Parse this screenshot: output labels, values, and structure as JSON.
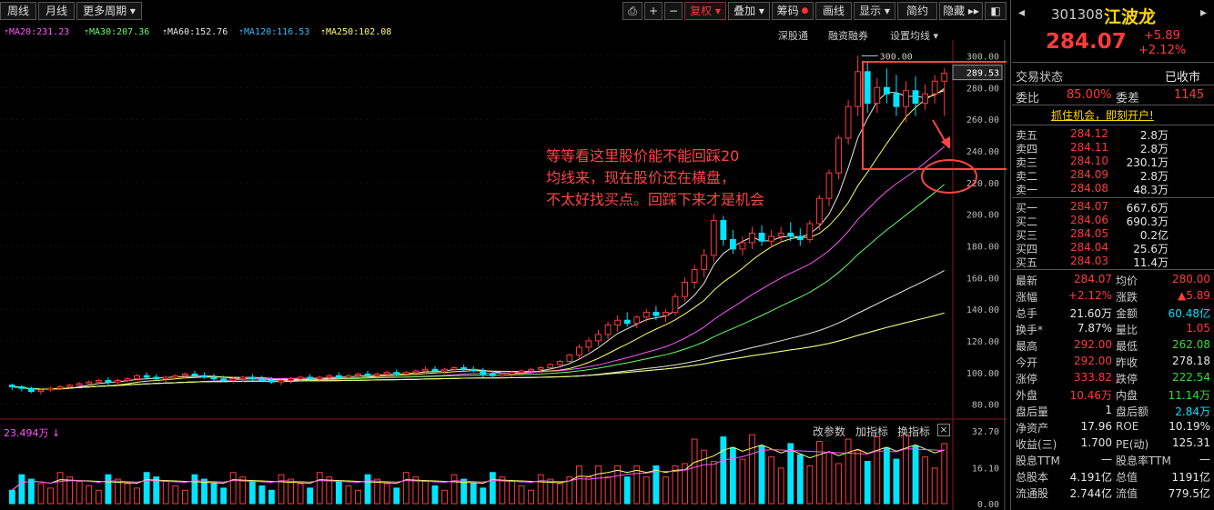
{
  "toolbar": {
    "weekly": "周线",
    "monthly": "月线",
    "more_period": "更多周期 ▾",
    "restore": "复权 ▾",
    "overlay": "叠加 ▾",
    "chips": "筹码",
    "draw": "画线",
    "display": "显示 ▾",
    "simple": "简约",
    "hide": "隐藏 ▸▸",
    "lock_icon": "lock-icon",
    "plus": "+",
    "minus": "−"
  },
  "ma_legend": [
    {
      "label": "MA20:231.23",
      "color": "#ff55ff"
    },
    {
      "label": "MA30:207.36",
      "color": "#66ff66"
    },
    {
      "label": "MA60:152.76",
      "color": "#e8e8e8"
    },
    {
      "label": "MA120:116.53",
      "color": "#33bbff"
    },
    {
      "label": "MA250:102.08",
      "color": "#ffff66"
    }
  ],
  "chart_links": {
    "sgt": "深股通",
    "margin": "融资融券",
    "set_ma": "设置均线 ▾"
  },
  "annotation": [
    "等等看这里股价能不能回踩20",
    "均线来，现在股价还在横盘，",
    "不太好找买点。回踩下来才是机会"
  ],
  "price_axis": {
    "ticks": [
      "300.00",
      "280.00",
      "260.00",
      "240.00",
      "220.00",
      "200.00",
      "180.00",
      "160.00",
      "140.00",
      "120.00",
      "100.00",
      "80.00"
    ],
    "current": "289.53",
    "high_marker": "300.00"
  },
  "volume_panel": {
    "ma_label": "23.494万 ↓",
    "buttons": {
      "params": "改参数",
      "add": "加指标",
      "switch": "换指标",
      "close": "×"
    },
    "ticks": [
      "32.70",
      "16.10",
      "0.00"
    ]
  },
  "stock": {
    "code": "301308",
    "name": "江波龙",
    "price": "284.07",
    "change": "+5.89",
    "pct": "+2.12%"
  },
  "trade_status": {
    "label": "交易状态",
    "value": "已收市"
  },
  "commission": {
    "ratio_label": "委比",
    "ratio": "85.00%",
    "diff_label": "委差",
    "diff": "1145"
  },
  "promo": "抓住机会，即刻开户!",
  "asks": [
    {
      "label": "卖五",
      "price": "284.12",
      "vol": "2.8万"
    },
    {
      "label": "卖四",
      "price": "284.11",
      "vol": "2.8万"
    },
    {
      "label": "卖三",
      "price": "284.10",
      "vol": "230.1万"
    },
    {
      "label": "卖二",
      "price": "284.09",
      "vol": "2.8万"
    },
    {
      "label": "卖一",
      "price": "284.08",
      "vol": "48.3万"
    }
  ],
  "bids": [
    {
      "label": "买一",
      "price": "284.07",
      "vol": "667.6万"
    },
    {
      "label": "买二",
      "price": "284.06",
      "vol": "690.3万"
    },
    {
      "label": "买三",
      "price": "284.05",
      "vol": "0.2亿"
    },
    {
      "label": "买四",
      "price": "284.04",
      "vol": "25.6万"
    },
    {
      "label": "买五",
      "price": "284.03",
      "vol": "11.4万"
    }
  ],
  "stats": [
    {
      "l1": "最新",
      "v1": "284.07",
      "c1": "red",
      "l2": "均价",
      "v2": "280.00",
      "c2": "red"
    },
    {
      "l1": "涨幅",
      "v1": "+2.12%",
      "c1": "red",
      "l2": "涨跌",
      "v2": "▲5.89",
      "c2": "red"
    },
    {
      "l1": "总手",
      "v1": "21.60万",
      "c1": "white",
      "l2": "金额",
      "v2": "60.48亿",
      "c2": "cyan"
    },
    {
      "l1": "换手*",
      "v1": "7.87%",
      "c1": "white",
      "l2": "量比",
      "v2": "1.05",
      "c2": "red"
    },
    {
      "l1": "最高",
      "v1": "292.00",
      "c1": "red",
      "l2": "最低",
      "v2": "262.08",
      "c2": "green"
    },
    {
      "l1": "今开",
      "v1": "292.00",
      "c1": "red",
      "l2": "昨收",
      "v2": "278.18",
      "c2": "white"
    },
    {
      "l1": "涨停",
      "v1": "333.82",
      "c1": "red",
      "l2": "跌停",
      "v2": "222.54",
      "c2": "green"
    },
    {
      "l1": "外盘",
      "v1": "10.46万",
      "c1": "red",
      "l2": "内盘",
      "v2": "11.14万",
      "c2": "green"
    },
    {
      "l1": "盘后量",
      "v1": "1",
      "c1": "white",
      "l2": "盘后额",
      "v2": "2.84万",
      "c2": "cyan"
    },
    {
      "l1": "净资产",
      "v1": "17.96",
      "c1": "white",
      "l2": "ROE",
      "v2": "10.19%",
      "c2": "white"
    },
    {
      "l1": "收益(三)",
      "v1": "1.700",
      "c1": "white",
      "l2": "PE(动)",
      "v2": "125.31",
      "c2": "white"
    },
    {
      "l1": "股息TTM",
      "v1": "—",
      "c1": "white",
      "l2": "股息率TTM",
      "v2": "—",
      "c2": "white"
    },
    {
      "l1": "总股本",
      "v1": "4.191亿",
      "c1": "white",
      "l2": "总值",
      "v2": "1191亿",
      "c2": "white"
    },
    {
      "l1": "流通股",
      "v1": "2.744亿",
      "c1": "white",
      "l2": "流值",
      "v2": "779.5亿",
      "c2": "white"
    }
  ],
  "chart_data": {
    "type": "candlestick",
    "ylim": [
      70,
      310
    ],
    "ytick_values": [
      300,
      280,
      260,
      240,
      220,
      200,
      180,
      160,
      140,
      120,
      100,
      80
    ],
    "candles": [
      [
        92,
        93,
        89,
        91
      ],
      [
        91,
        92,
        88,
        90
      ],
      [
        90,
        91,
        87,
        88
      ],
      [
        88,
        90,
        86,
        89
      ],
      [
        89,
        91,
        88,
        90
      ],
      [
        90,
        92,
        89,
        91
      ],
      [
        91,
        93,
        90,
        92
      ],
      [
        92,
        94,
        91,
        93
      ],
      [
        93,
        95,
        92,
        94
      ],
      [
        94,
        96,
        93,
        95
      ],
      [
        95,
        97,
        92,
        94
      ],
      [
        94,
        96,
        92,
        95
      ],
      [
        95,
        97,
        94,
        96
      ],
      [
        96,
        99,
        95,
        98
      ],
      [
        98,
        100,
        96,
        97
      ],
      [
        97,
        99,
        95,
        96
      ],
      [
        96,
        98,
        94,
        97
      ],
      [
        97,
        99,
        96,
        98
      ],
      [
        98,
        100,
        96,
        99
      ],
      [
        99,
        101,
        97,
        98
      ],
      [
        98,
        100,
        96,
        97
      ],
      [
        97,
        99,
        95,
        96
      ],
      [
        96,
        98,
        94,
        95
      ],
      [
        95,
        97,
        93,
        96
      ],
      [
        96,
        98,
        94,
        97
      ],
      [
        97,
        99,
        95,
        96
      ],
      [
        96,
        98,
        94,
        95
      ],
      [
        95,
        97,
        93,
        94
      ],
      [
        94,
        96,
        92,
        95
      ],
      [
        95,
        97,
        93,
        96
      ],
      [
        96,
        98,
        94,
        97
      ],
      [
        97,
        99,
        95,
        96
      ],
      [
        96,
        98,
        94,
        97
      ],
      [
        97,
        99,
        95,
        98
      ],
      [
        98,
        100,
        96,
        97
      ],
      [
        97,
        99,
        96,
        98
      ],
      [
        98,
        100,
        97,
        99
      ],
      [
        99,
        101,
        97,
        98
      ],
      [
        98,
        100,
        96,
        99
      ],
      [
        99,
        101,
        97,
        100
      ],
      [
        100,
        102,
        98,
        99
      ],
      [
        99,
        101,
        97,
        100
      ],
      [
        100,
        102,
        98,
        101
      ],
      [
        101,
        104,
        99,
        102
      ],
      [
        102,
        104,
        100,
        101
      ],
      [
        101,
        103,
        99,
        102
      ],
      [
        102,
        104,
        100,
        103
      ],
      [
        103,
        105,
        101,
        102
      ],
      [
        102,
        104,
        100,
        101
      ],
      [
        101,
        103,
        97,
        99
      ],
      [
        99,
        101,
        96,
        98
      ],
      [
        98,
        100,
        96,
        99
      ],
      [
        99,
        101,
        97,
        100
      ],
      [
        100,
        102,
        98,
        101
      ],
      [
        101,
        103,
        99,
        102
      ],
      [
        102,
        104,
        100,
        103
      ],
      [
        103,
        106,
        101,
        105
      ],
      [
        105,
        108,
        103,
        107
      ],
      [
        107,
        112,
        105,
        111
      ],
      [
        111,
        118,
        109,
        116
      ],
      [
        116,
        122,
        113,
        120
      ],
      [
        120,
        127,
        117,
        124
      ],
      [
        124,
        132,
        121,
        130
      ],
      [
        130,
        136,
        126,
        133
      ],
      [
        133,
        138,
        129,
        131
      ],
      [
        131,
        136,
        128,
        135
      ],
      [
        135,
        140,
        132,
        138
      ],
      [
        138,
        142,
        133,
        136
      ],
      [
        136,
        140,
        132,
        138
      ],
      [
        138,
        150,
        136,
        148
      ],
      [
        148,
        160,
        145,
        157
      ],
      [
        157,
        168,
        153,
        165
      ],
      [
        165,
        178,
        160,
        174
      ],
      [
        174,
        200,
        170,
        196
      ],
      [
        196,
        199,
        180,
        184
      ],
      [
        184,
        190,
        175,
        178
      ],
      [
        178,
        186,
        174,
        182
      ],
      [
        182,
        192,
        178,
        188
      ],
      [
        188,
        193,
        180,
        183
      ],
      [
        183,
        190,
        179,
        186
      ],
      [
        186,
        192,
        182,
        188
      ],
      [
        188,
        195,
        183,
        186
      ],
      [
        186,
        191,
        180,
        184
      ],
      [
        184,
        196,
        182,
        194
      ],
      [
        194,
        212,
        190,
        210
      ],
      [
        210,
        228,
        205,
        226
      ],
      [
        226,
        250,
        222,
        248
      ],
      [
        248,
        272,
        244,
        268
      ],
      [
        268,
        300,
        262,
        290
      ],
      [
        290,
        296,
        264,
        270
      ],
      [
        270,
        286,
        264,
        280
      ],
      [
        280,
        292,
        270,
        276
      ],
      [
        276,
        288,
        262,
        268
      ],
      [
        268,
        284,
        258,
        278
      ],
      [
        278,
        287,
        262,
        270
      ],
      [
        270,
        282,
        266,
        276
      ],
      [
        276,
        288,
        270,
        284
      ],
      [
        284,
        292,
        262,
        289
      ]
    ],
    "ma_series": [
      {
        "name": "MA20",
        "color": "#ff55ff",
        "last": 231.23
      },
      {
        "name": "MA30",
        "color": "#66ff66",
        "last": 207.36
      },
      {
        "name": "MA60",
        "color": "#e8e8e8",
        "last": 152.76
      },
      {
        "name": "MA120",
        "color": "#33bbff",
        "last": 116.53
      },
      {
        "name": "MA250",
        "color": "#ffff66",
        "last": 102.08
      }
    ],
    "volume_ylim": [
      0,
      32.7
    ]
  }
}
